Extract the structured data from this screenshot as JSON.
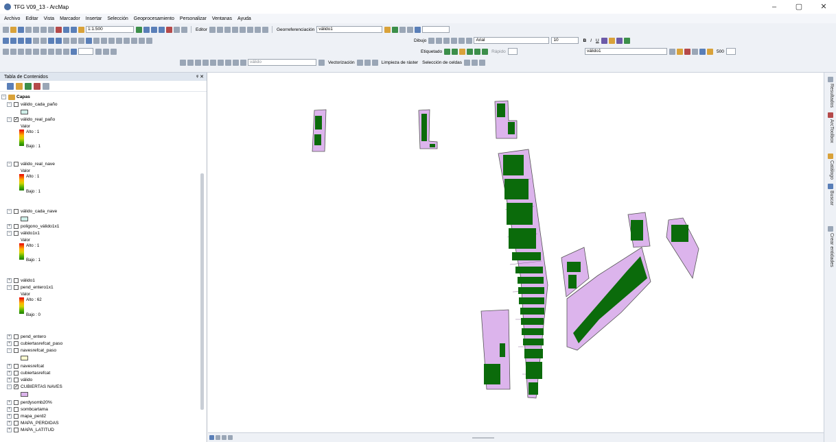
{
  "window": {
    "title": "TFG V09_13 - ArcMap",
    "min": "–",
    "max": "▢",
    "close": "✕"
  },
  "menu": [
    "Archivo",
    "Editar",
    "Vista",
    "Marcador",
    "Insertar",
    "Selección",
    "Geoprocesamiento",
    "Personalizar",
    "Ventanas",
    "Ayuda"
  ],
  "toolbar": {
    "scale": "1:1.500",
    "editor": "Editor",
    "georef": "Georreferenciación",
    "georef_layer": "válido1",
    "dibujo": "Dibujo",
    "font": "Arial",
    "font_size": "10",
    "bold": "B",
    "italic": "I",
    "underline": "U",
    "etiquetado": "Etiquetado",
    "rapido": "Rápido",
    "layer_select": "válido1",
    "buffer_value": "500",
    "valid_box": "válido",
    "vectorizacion": "Vectorización",
    "limpieza": "Limpieza de ráster",
    "seleccion_celdas": "Selección de celdas"
  },
  "toc": {
    "title": "Tabla de Contenidos",
    "pin": "ᵠ ✕",
    "root": "Capas",
    "valor": "Valor",
    "layers": [
      {
        "name": "válido_cada_paño",
        "checked": false
      },
      {
        "name": "válido_real_paño",
        "checked": true,
        "alto": "Alto : 1",
        "bajo": "Bajo : 1"
      },
      {
        "name": "válido_real_nave",
        "checked": false,
        "alto": "Alto : 1",
        "bajo": "Bajo : 1"
      },
      {
        "name": "válido_cada_nave",
        "checked": false
      },
      {
        "name": "poligono_válido1x1",
        "checked": false
      },
      {
        "name": "válido1x1",
        "checked": false,
        "alto": "Alto : 1",
        "bajo": "Bajo : 1"
      },
      {
        "name": "válido1",
        "checked": false
      },
      {
        "name": "pend_entero1x1",
        "checked": false,
        "alto": "Alto : 62",
        "bajo": "Bajo : 0"
      },
      {
        "name": "pend_entero",
        "checked": false
      },
      {
        "name": "cubiertasrefcat_paso",
        "checked": false
      },
      {
        "name": "navesrefcat_paso",
        "checked": false
      },
      {
        "name": "navesrefcat",
        "checked": false
      },
      {
        "name": "cubiertasrefcat",
        "checked": false
      },
      {
        "name": "válido",
        "checked": false
      },
      {
        "name": "CUBIERTAS NAVES",
        "checked": true
      },
      {
        "name": "perdysomb20%",
        "checked": false
      },
      {
        "name": "sombcartama",
        "checked": false
      },
      {
        "name": "mapa_perd2",
        "checked": false
      },
      {
        "name": "MAPA_PERDIDAS",
        "checked": false
      },
      {
        "name": "MAPA_LATITUD",
        "checked": false
      }
    ]
  },
  "sidebar": [
    "Resultados",
    "ArcToolbox",
    "Catálogo",
    "Buscar",
    "Crear entidades"
  ],
  "colors": {
    "polygon_fill": "#dcb4ec",
    "polygon_stroke": "#555555",
    "raster_valid": "#0b6b0b"
  }
}
